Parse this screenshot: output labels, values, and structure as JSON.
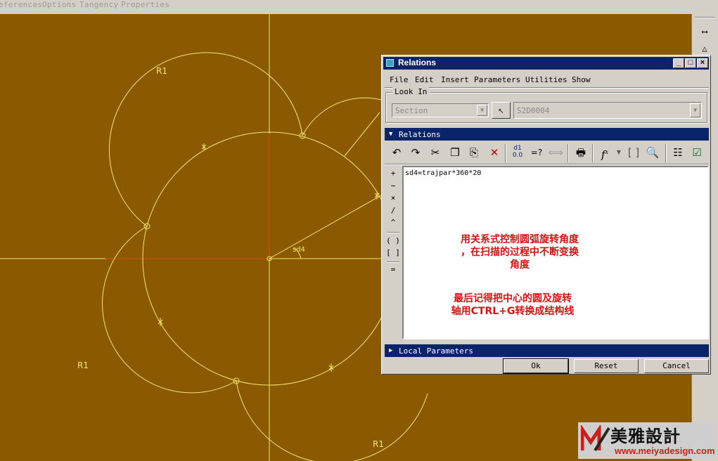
{
  "app_menu": [
    "eferences",
    "Options",
    "Tangency",
    "Properties"
  ],
  "sketch": {
    "radius_labels": [
      "R1",
      "R1",
      "R1"
    ],
    "angle_label": "sd4"
  },
  "right_toolbar": {
    "icons": [
      "dimension-icon",
      "triangle-icon"
    ]
  },
  "dialog": {
    "title": "Relations",
    "window_buttons": [
      "_",
      "□",
      "×"
    ],
    "menu": [
      "File",
      "Edit",
      "Insert",
      "Parameters",
      "Utilities",
      "Show"
    ],
    "look_in": {
      "label": "Look In",
      "type_value": "Section",
      "item_value": "S2D0004"
    },
    "relations_section": "Relations",
    "toolbar_icons": [
      "undo-icon",
      "redo-icon",
      "cut-icon",
      "copy-icon",
      "paste-icon",
      "delete-icon",
      "evaluate-icon",
      "verify-icon",
      "dimension-toggle-icon",
      "sort-icon",
      "function-icon",
      "parameter-icon",
      "relation-check-icon",
      "info-icon",
      "verify-relations-icon"
    ],
    "operators": [
      "+",
      "−",
      "×",
      "/",
      "^",
      "( )",
      "[ ]",
      "="
    ],
    "relation_text": "sd4=trajpar*360*20",
    "local_parameters_section": "Local Parameters",
    "buttons": {
      "ok": "Ok",
      "reset": "Reset",
      "cancel": "Cancel"
    }
  },
  "annotations": {
    "note1_line1": "用关系式控制圆弧旋转角度",
    "note1_line2": "，在扫描的过程中不断变换",
    "note1_line3": "角度",
    "note2_line1": "最后记得把中心的圆及旋转",
    "note2_line2": "轴用CTRL+G转换成结构线"
  },
  "watermark": {
    "brand": "美雅設計",
    "url": "www.meiyadesign.com"
  },
  "colors": {
    "canvas": "#8b5a00",
    "sketch_line": "#f0e86a",
    "axis_center": "#d84a20",
    "title_bar": "#0a246a",
    "annotation": "#e01010"
  }
}
